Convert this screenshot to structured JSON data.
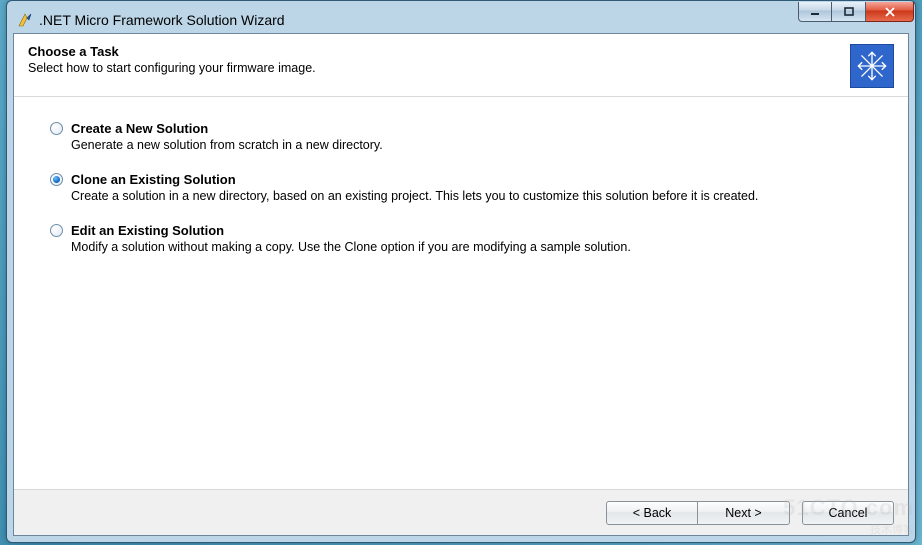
{
  "window": {
    "title": ".NET Micro Framework Solution Wizard"
  },
  "header": {
    "title": "Choose a Task",
    "subtitle": "Select how to start configuring your firmware image."
  },
  "options": [
    {
      "id": "create",
      "label": "Create a New Solution",
      "description": "Generate a new solution from scratch in a new directory.",
      "selected": false
    },
    {
      "id": "clone",
      "label": "Clone an Existing Solution",
      "description": "Create a solution in a new directory, based on an existing project. This lets you to customize this solution before it is created.",
      "selected": true
    },
    {
      "id": "edit",
      "label": "Edit an Existing Solution",
      "description": "Modify a solution without making a copy. Use the Clone option if you are modifying a sample solution.",
      "selected": false
    }
  ],
  "buttons": {
    "back": "< Back",
    "next": "Next >",
    "cancel": "Cancel"
  },
  "watermark": {
    "line1": "51CTO.com",
    "line2": "技术博客"
  }
}
